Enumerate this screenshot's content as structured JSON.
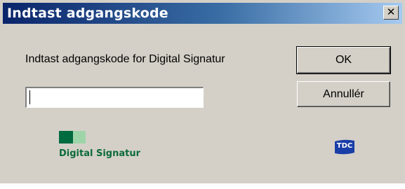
{
  "window": {
    "title": "Indtast adgangskode",
    "close_glyph": "✕"
  },
  "dialog": {
    "prompt": "Indtast adgangskode for Digital Signatur",
    "password_value": "",
    "ok_label": "OK",
    "cancel_label": "Annullér"
  },
  "logos": {
    "digital_signatur_text": "Digital Signatur",
    "toc_text": "TDC"
  },
  "colors": {
    "titlebar_start": "#0a246a",
    "titlebar_end": "#a6caf0",
    "dialog_bg": "#d4d0c8",
    "brand_green_dark": "#006b3f",
    "brand_green_light": "#9ed5a8",
    "toc_blue": "#1a3ea8"
  }
}
